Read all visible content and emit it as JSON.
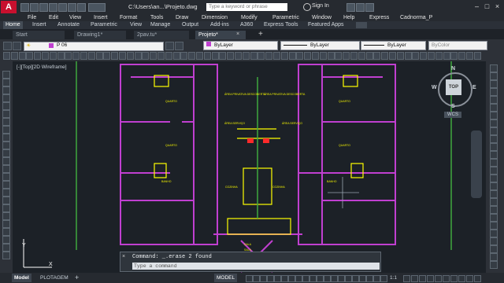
{
  "app": {
    "logo": "A",
    "title": "C:\\Users\\an...\\Projeto.dwg",
    "search_placeholder": "Type a keyword or phrase",
    "signin": "Sign In"
  },
  "menu": [
    "File",
    "Edit",
    "View",
    "Insert",
    "Format",
    "Tools",
    "Draw",
    "Dimension",
    "Modify",
    "Parametric",
    "Window",
    "Help",
    "Express",
    "Cadnorma_P"
  ],
  "ribbon_tabs": [
    "Home",
    "Insert",
    "Annotate",
    "Parametric",
    "View",
    "Manage",
    "Output",
    "Add-ins",
    "A360",
    "Express Tools",
    "Featured Apps"
  ],
  "ribbon_active": "Home",
  "file_tabs": [
    "Start",
    "Drawing1*",
    "2pav.tu*",
    "Projeto*"
  ],
  "file_tab_active": "Projeto*",
  "properties": {
    "layer": "P 06",
    "color": "ByLayer",
    "linetype": "ByLayer",
    "lineweight": "ByLayer",
    "plotstyle": "ByColor"
  },
  "viewport": {
    "label": "[-][Top][2D Wireframe]"
  },
  "navcube": {
    "face": "TOP",
    "north": "N",
    "south": "S",
    "east": "E",
    "west": "W",
    "ucs": "WCS"
  },
  "command": {
    "history": "Command: _.erase 2 found",
    "placeholder": "Type a command"
  },
  "status": {
    "layout_tabs": [
      "Model",
      "PLOTAGEM"
    ],
    "mode": "MODEL",
    "scale": "1:1"
  },
  "floorplan": {
    "room_labels": [
      "ÁREA PRIVATIVA DESCOBERTA",
      "ÁREA PRIVATIVA DESCOBERTA",
      "ÁREA SERVIÇO",
      "ÁREA SERVIÇO",
      "COZINHA",
      "COZINHA",
      "BANHO",
      "BANHO",
      "QUARTO",
      "QUARTO",
      "QUARTO",
      "QUARTO",
      "SALA",
      "SALA"
    ]
  },
  "colors": {
    "walls": "#c03fd0",
    "lines": "#ffff00",
    "axis": "#40d040",
    "accent": "#ff2a2a"
  }
}
